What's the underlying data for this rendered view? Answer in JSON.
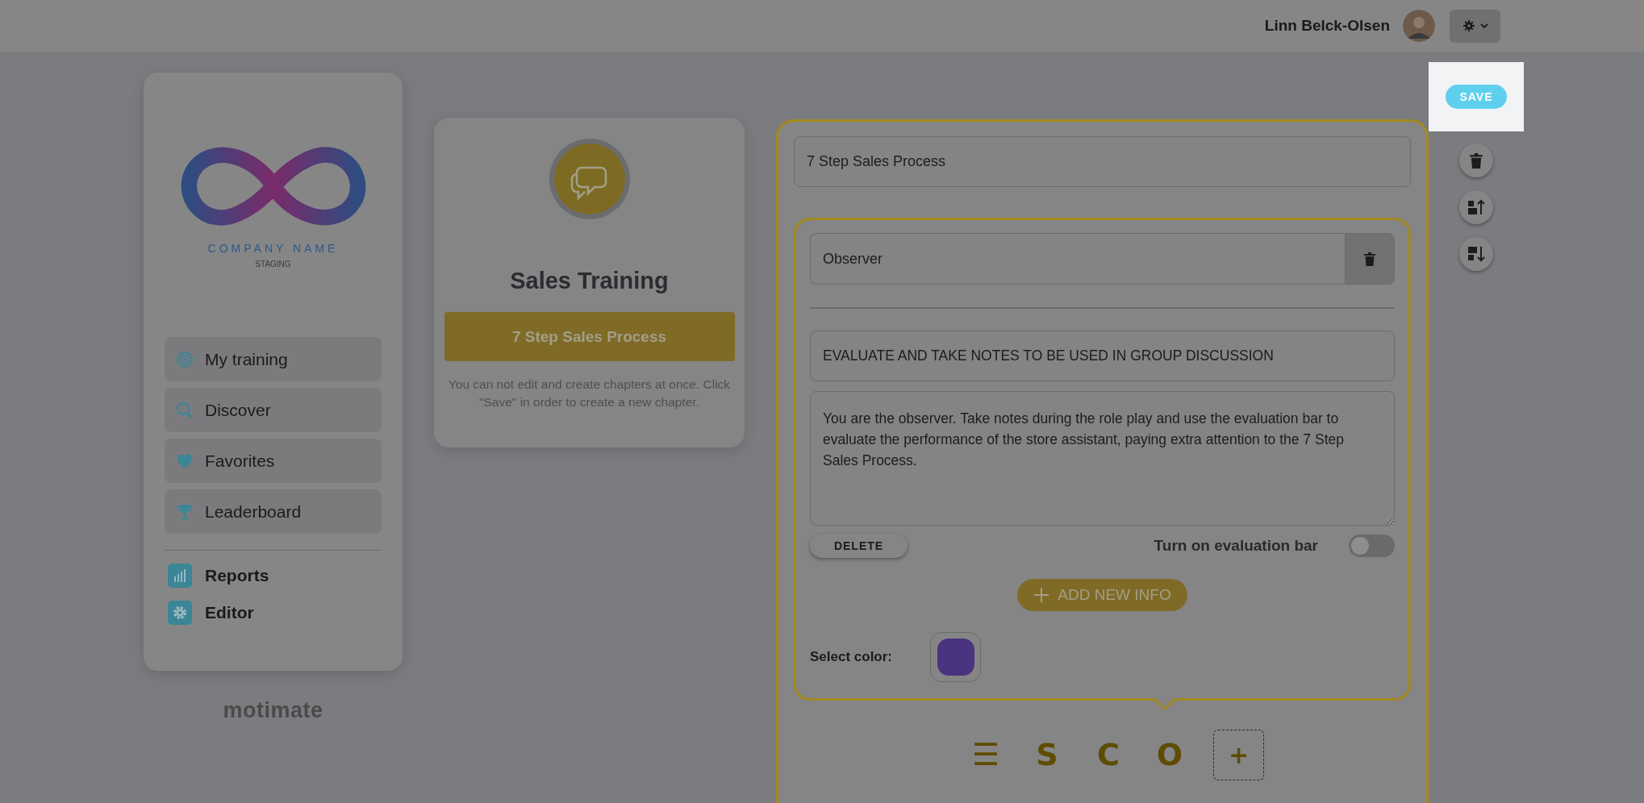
{
  "header": {
    "user_name": "Linn Belck-Olsen"
  },
  "sidebar": {
    "company_name": "COMPANY NAME",
    "company_subtitle": "STAGING",
    "nav_items": [
      {
        "label": "My training"
      },
      {
        "label": "Discover"
      },
      {
        "label": "Favorites"
      },
      {
        "label": "Leaderboard"
      }
    ],
    "admin_items": [
      {
        "label": "Reports"
      },
      {
        "label": "Editor"
      }
    ],
    "footer_brand": "motimate"
  },
  "course": {
    "title": "Sales Training",
    "chapter_button": "7 Step Sales Process",
    "note": "You can not edit and create chapters at once. Click \"Save\" in order to create a new chapter."
  },
  "editor": {
    "title_value": "7 Step Sales Process",
    "section": {
      "name_value": "Observer",
      "heading_value": "EVALUATE AND TAKE NOTES TO BE USED IN GROUP DISCUSSION",
      "body_value": "You are the observer. Take notes during the role play and use the evaluation bar to evaluate the performance of the store assistant, paying extra attention to the 7 Step Sales Process.",
      "delete_label": "DELETE",
      "evaluation_label": "Turn on evaluation bar",
      "evaluation_on": false,
      "add_label": "ADD NEW INFO",
      "color_label": "Select color:",
      "color": "#4a3380"
    },
    "section_tabs": [
      {
        "label": "☰",
        "kind": "text"
      },
      {
        "label": "S",
        "kind": "text"
      },
      {
        "label": "C",
        "kind": "text"
      },
      {
        "label": "O",
        "kind": "text"
      },
      {
        "label": "+",
        "kind": "add"
      }
    ]
  },
  "save_label": "SAVE"
}
